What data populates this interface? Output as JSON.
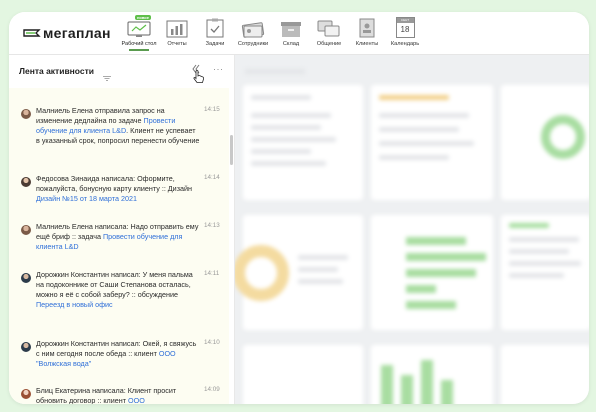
{
  "brand": {
    "logo_text": "мегаплан"
  },
  "nav": {
    "items": [
      {
        "label": "Рабочий стол",
        "icon": "desktop-icon",
        "active": true,
        "badge": "новое"
      },
      {
        "label": "Отчеты",
        "icon": "reports-icon"
      },
      {
        "label": "Задачи",
        "icon": "tasks-icon"
      },
      {
        "label": "Сотрудники",
        "icon": "employees-icon"
      },
      {
        "label": "Склад",
        "icon": "warehouse-icon"
      },
      {
        "label": "Общение",
        "icon": "chat-icon"
      },
      {
        "label": "Клиенты",
        "icon": "clients-icon"
      },
      {
        "label": "Календарь",
        "icon": "calendar-icon",
        "calendar_day": "18",
        "calendar_month": "СЕНТ"
      }
    ]
  },
  "activity": {
    "title": "Лента активности",
    "items": [
      {
        "text": "Малниель Елена отправила запрос на изменение дедлайна по задаче ",
        "link": "Провести обучение для клиента L&D",
        "tail": ". Клиент не успевает в указанный срок, попросил перенести обучение",
        "time": "14:15"
      },
      {
        "text": "Федосова Зинаида написала: Оформите, пожалуйста, бонусную карту клиенту :: Дизайн ",
        "link": "Дизайн №15 от 18 марта 2021",
        "tail": "",
        "time": "14:14"
      },
      {
        "text": "Малниель Елена написала: Надо отправить ему ещё бриф :: задача ",
        "link": "Провести обучение для клиента L&D",
        "tail": "",
        "time": "14:13"
      },
      {
        "text": "Дорожкин Константин написал: У меня пальма на подоконнике от Саши Степанова осталась, можно я её с собой заберу? :: обсуждение ",
        "link": "Переезд в новый офис",
        "tail": "",
        "time": "14:11"
      },
      {
        "text": "Дорожкин Константин написал: Окей, я свяжусь с ним сегодня после обеда :: клиент ",
        "link": "ООО \"Волжская вода\"",
        "tail": "",
        "time": "14:10"
      },
      {
        "text": "Блиц Екатерина написала: Клиент просит обновить договор :: клиент ",
        "link": "ООО",
        "tail": "",
        "time": "14:09"
      }
    ]
  },
  "colors": {
    "accent": "#5a9b4f",
    "link": "#2f6fd8",
    "feed_bg": "#fdfdf2",
    "outer_bg": "#e3f6e1"
  }
}
